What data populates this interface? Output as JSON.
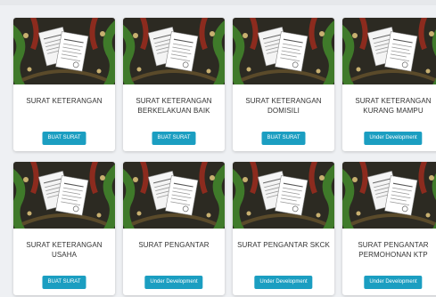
{
  "cards": [
    {
      "title": "SURAT KETERANGAN",
      "button": "BUAT SURAT"
    },
    {
      "title": "SURAT KETERANGAN\nBERKELAKUAN BAIK",
      "button": "BUAT SURAT"
    },
    {
      "title": "SURAT KETERANGAN\nDOMISILI",
      "button": "BUAT SURAT"
    },
    {
      "title": "SURAT KETERANGAN\nKURANG MAMPU",
      "button": "Under Development"
    },
    {
      "title": "SURAT KETERANGAN\nUSAHA",
      "button": "BUAT SURAT"
    },
    {
      "title": "SURAT PENGANTAR",
      "button": "Under Development"
    },
    {
      "title": "SURAT PENGANTAR SKCK",
      "button": "Under Development"
    },
    {
      "title": "SURAT PENGANTAR\nPERMOHONAN KTP",
      "button": "Under Development"
    }
  ],
  "colors": {
    "button": "#1b9ec1",
    "banner_bg": "#2c2a22",
    "banner_green": "#3f7a2a",
    "banner_red": "#8c2b1e"
  },
  "icons": {
    "thumbnail": "document-illustration-icon"
  }
}
